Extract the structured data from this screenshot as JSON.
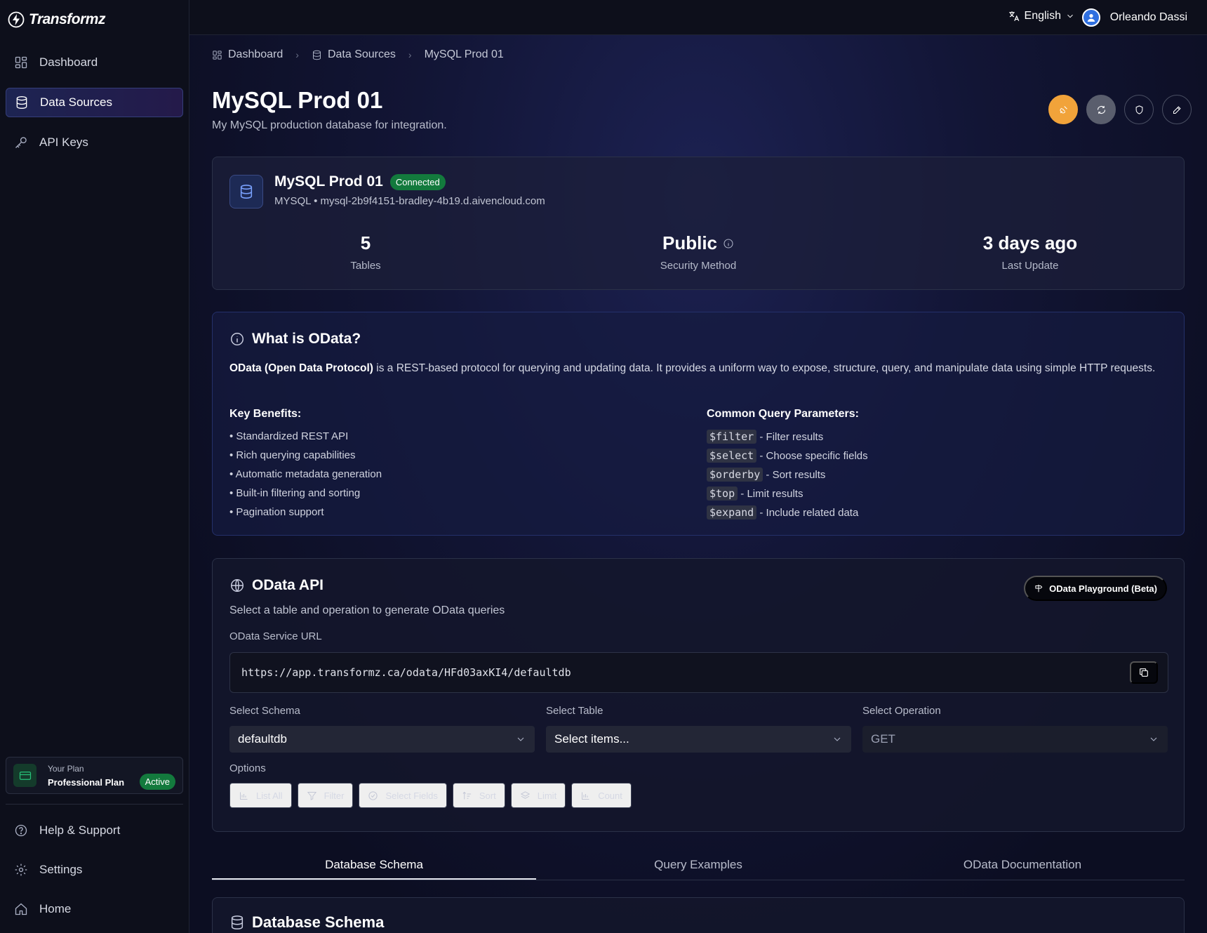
{
  "app": {
    "name": "Transformz"
  },
  "sidebar": {
    "items": [
      {
        "label": "Dashboard",
        "icon": "grid-icon",
        "active": false
      },
      {
        "label": "Data Sources",
        "icon": "database-icon",
        "active": true
      },
      {
        "label": "API Keys",
        "icon": "key-icon",
        "active": false
      }
    ],
    "plan": {
      "label": "Your Plan",
      "name": "Professional Plan",
      "status": "Active"
    },
    "bottom": [
      {
        "label": "Help & Support",
        "icon": "help-icon"
      },
      {
        "label": "Settings",
        "icon": "gear-icon"
      },
      {
        "label": "Home",
        "icon": "home-icon"
      }
    ]
  },
  "topbar": {
    "language": "English",
    "user": "Orleando Dassi"
  },
  "breadcrumb": [
    "Dashboard",
    "Data Sources",
    "MySQL Prod 01"
  ],
  "page": {
    "title": "MySQL Prod 01",
    "subtitle": "My MySQL production database for integration."
  },
  "source": {
    "name": "MySQL Prod 01",
    "status": "Connected",
    "host": "MYSQL • mysql-2b9f4151-bradley-4b19.d.aivencloud.com",
    "stats": [
      {
        "value": "5",
        "label": "Tables"
      },
      {
        "value": "Public",
        "label": "Security Method"
      },
      {
        "value": "3 days ago",
        "label": "Last Update"
      }
    ]
  },
  "odata_info": {
    "title": "What is OData?",
    "desc_bold": "OData (Open Data Protocol)",
    "desc_rest": " is a REST-based protocol for querying and updating data. It provides a uniform way to expose, structure, query, and manipulate data using simple HTTP requests.",
    "benefits_title": "Key Benefits:",
    "benefits": [
      "• Standardized REST API",
      "• Rich querying capabilities",
      "• Automatic metadata generation",
      "• Built-in filtering and sorting",
      "• Pagination support"
    ],
    "params_title": "Common Query Parameters:",
    "params": [
      {
        "code": "$filter",
        "desc": " - Filter results"
      },
      {
        "code": "$select",
        "desc": " - Choose specific fields"
      },
      {
        "code": "$orderby",
        "desc": " - Sort results"
      },
      {
        "code": "$top",
        "desc": " - Limit results"
      },
      {
        "code": "$expand",
        "desc": " - Include related data"
      }
    ]
  },
  "odata_api": {
    "title": "OData API",
    "subtitle": "Select a table and operation to generate OData queries",
    "playground": "OData Playground (Beta)",
    "url_label": "OData Service URL",
    "url": "https://app.transformz.ca/odata/HFd03axKI4/defaultdb",
    "schema_label": "Select Schema",
    "schema_value": "defaultdb",
    "table_label": "Select Table",
    "table_value": "Select items...",
    "operation_label": "Select Operation",
    "operation_value": "GET",
    "options_label": "Options",
    "options": [
      "List All",
      "Filter",
      "Select Fields",
      "Sort",
      "Limit",
      "Count"
    ]
  },
  "tabs": [
    "Database Schema",
    "Query Examples",
    "OData Documentation"
  ],
  "schema_card": {
    "title": "Database Schema"
  },
  "colors": {
    "accent": "#f1a33a",
    "success": "#137a3d",
    "primary": "#2f6fe0"
  }
}
